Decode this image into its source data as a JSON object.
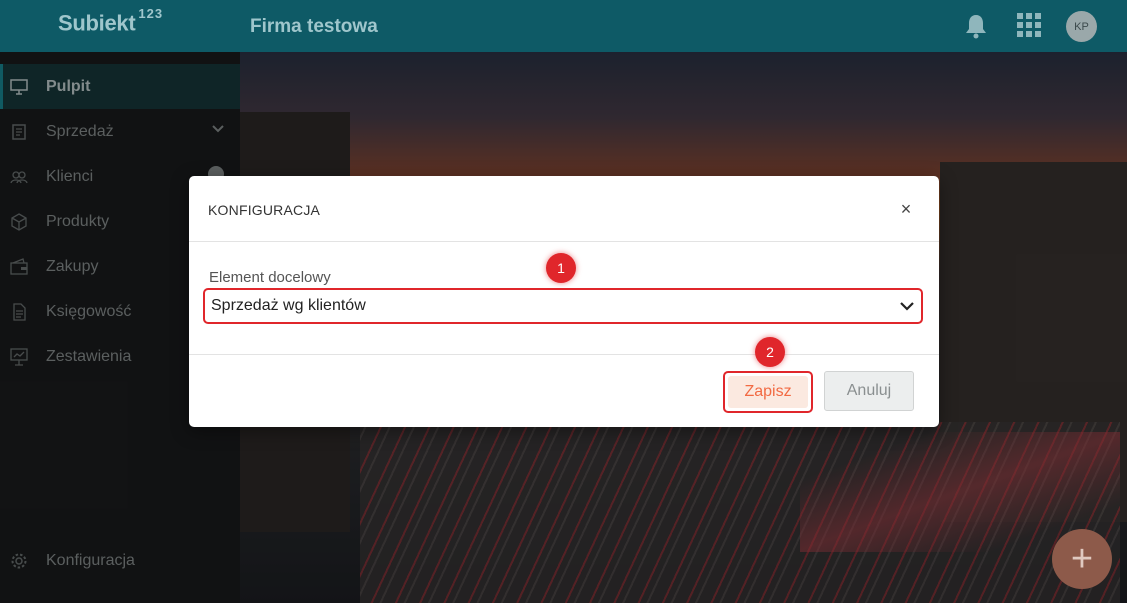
{
  "app": {
    "logo": "Subiekt",
    "logo_sup": "123",
    "company": "Firma testowa",
    "avatar_initials": "KP",
    "colors": {
      "topbar": "#0e5a66",
      "sidebar": "#1b1d1e",
      "accent": "#e0262b",
      "save_text": "#f26a43"
    }
  },
  "topbar": {
    "bell_icon": "bell-icon",
    "apps_icon": "apps-grid-icon"
  },
  "sidebar": {
    "items": [
      {
        "label": "Pulpit",
        "icon": "desktop-icon",
        "active": true
      },
      {
        "label": "Sprzedaż",
        "icon": "sales-icon",
        "expandable": true
      },
      {
        "label": "Klienci",
        "icon": "clients-icon",
        "add": true
      },
      {
        "label": "Produkty",
        "icon": "box-icon"
      },
      {
        "label": "Zakupy",
        "icon": "wallet-icon"
      },
      {
        "label": "Księgowość",
        "icon": "document-icon"
      },
      {
        "label": "Zestawienia",
        "icon": "chart-board-icon"
      }
    ],
    "bottom_item": {
      "label": "Konfiguracja",
      "icon": "gear-icon"
    }
  },
  "dialog": {
    "title": "KONFIGURACJA",
    "close": "×",
    "field_label": "Element docelowy",
    "select_value": "Sprzedaż wg klientów",
    "save_label": "Zapisz",
    "cancel_label": "Anuluj",
    "badge_1": "1",
    "badge_2": "2"
  },
  "fab": {
    "label": "+"
  }
}
